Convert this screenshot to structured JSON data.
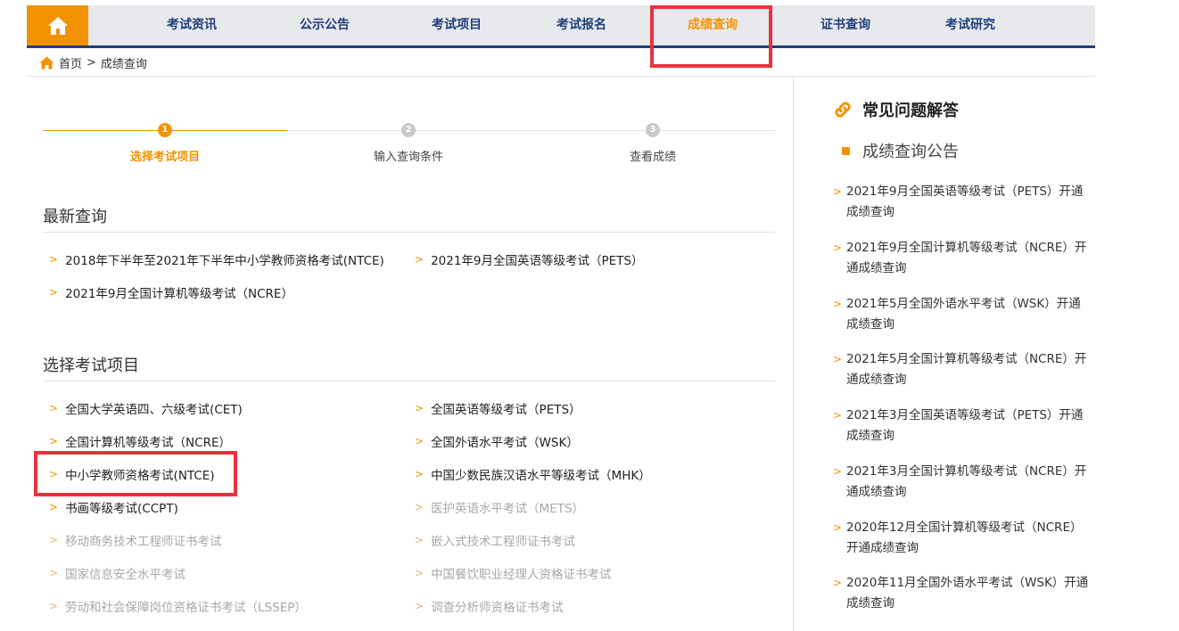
{
  "nav": {
    "items": [
      {
        "label": "考试资讯"
      },
      {
        "label": "公示公告"
      },
      {
        "label": "考试项目"
      },
      {
        "label": "考试报名"
      },
      {
        "label": "成绩查询",
        "active": true
      },
      {
        "label": "证书查询"
      },
      {
        "label": "考试研究"
      }
    ]
  },
  "breadcrumb": {
    "home": "首页",
    "separator": ">",
    "current": "成绩查询"
  },
  "steps": [
    {
      "num": "1",
      "label": "选择考试项目",
      "active": true
    },
    {
      "num": "2",
      "label": "输入查询条件",
      "active": false
    },
    {
      "num": "3",
      "label": "查看成绩",
      "active": false
    }
  ],
  "latest": {
    "title": "最新查询",
    "items": [
      "2018年下半年至2021年下半年中小学教师资格考试(NTCE)",
      "2021年9月全国英语等级考试（PETS）",
      "2021年9月全国计算机等级考试（NCRE）"
    ]
  },
  "select": {
    "title": "选择考试项目",
    "items": [
      {
        "label": "全国大学英语四、六级考试(CET)",
        "enabled": true
      },
      {
        "label": "全国英语等级考试（PETS）",
        "enabled": true
      },
      {
        "label": "全国计算机等级考试（NCRE）",
        "enabled": true
      },
      {
        "label": "全国外语水平考试（WSK）",
        "enabled": true
      },
      {
        "label": "中小学教师资格考试(NTCE)",
        "enabled": true
      },
      {
        "label": "中国少数民族汉语水平等级考试（MHK）",
        "enabled": true
      },
      {
        "label": "书画等级考试(CCPT)",
        "enabled": true
      },
      {
        "label": "医护英语水平考试（METS）",
        "enabled": false
      },
      {
        "label": "移动商务技术工程师证书考试",
        "enabled": false
      },
      {
        "label": "嵌入式技术工程师证书考试",
        "enabled": false
      },
      {
        "label": "国家信息安全水平考试",
        "enabled": false
      },
      {
        "label": "中国餐饮职业经理人资格证书考试",
        "enabled": false
      },
      {
        "label": "劳动和社会保障岗位资格证书考试（LSSEP）",
        "enabled": false
      },
      {
        "label": "调查分析师资格证书考试",
        "enabled": false
      }
    ]
  },
  "sidebar": {
    "faq_title": "常见问题解答",
    "sub_title": "成绩查询公告",
    "news": [
      "2021年9月全国英语等级考试（PETS）开通成绩查询",
      "2021年9月全国计算机等级考试（NCRE）开通成绩查询",
      "2021年5月全国外语水平考试（WSK）开通成绩查询",
      "2021年5月全国计算机等级考试（NCRE）开通成绩查询",
      "2021年3月全国英语等级考试（PETS）开通成绩查询",
      "2021年3月全国计算机等级考试（NCRE）开通成绩查询",
      "2020年12月全国计算机等级考试（NCRE）开通成绩查询",
      "2020年11月全国外语水平考试（WSK）开通成绩查询"
    ]
  },
  "colors": {
    "accent": "#f39200",
    "nav_text": "#1f3f7a",
    "highlight": "#e8323c",
    "disabled_text": "#a8a8a8"
  }
}
